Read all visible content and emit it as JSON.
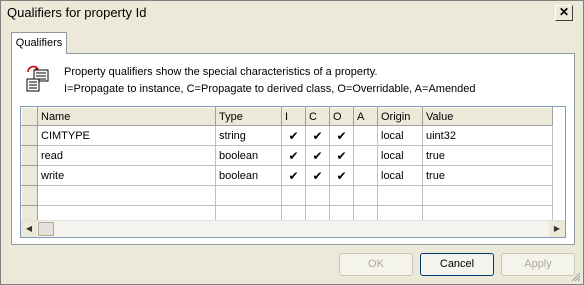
{
  "window": {
    "title": "Qualifiers for property Id",
    "close_glyph": "✕"
  },
  "tabs": [
    {
      "label": "Qualifiers",
      "active": true
    }
  ],
  "description": {
    "line1": "Property qualifiers show the special characteristics of a property.",
    "line2": "I=Propagate to instance, C=Propagate to derived class, O=Overridable, A=Amended"
  },
  "grid": {
    "columns": [
      "Name",
      "Type",
      "I",
      "C",
      "O",
      "A",
      "Origin",
      "Value"
    ],
    "rows": [
      {
        "name": "CIMTYPE",
        "type": "string",
        "i": "✔",
        "c": "✔",
        "o": "✔",
        "a": "",
        "origin": "local",
        "value": "uint32"
      },
      {
        "name": "read",
        "type": "boolean",
        "i": "✔",
        "c": "✔",
        "o": "✔",
        "a": "",
        "origin": "local",
        "value": "true"
      },
      {
        "name": "write",
        "type": "boolean",
        "i": "✔",
        "c": "✔",
        "o": "✔",
        "a": "",
        "origin": "local",
        "value": "true"
      }
    ]
  },
  "scroll": {
    "left_glyph": "◀",
    "right_glyph": "▶"
  },
  "buttons": {
    "ok": "OK",
    "cancel": "Cancel",
    "apply": "Apply"
  }
}
